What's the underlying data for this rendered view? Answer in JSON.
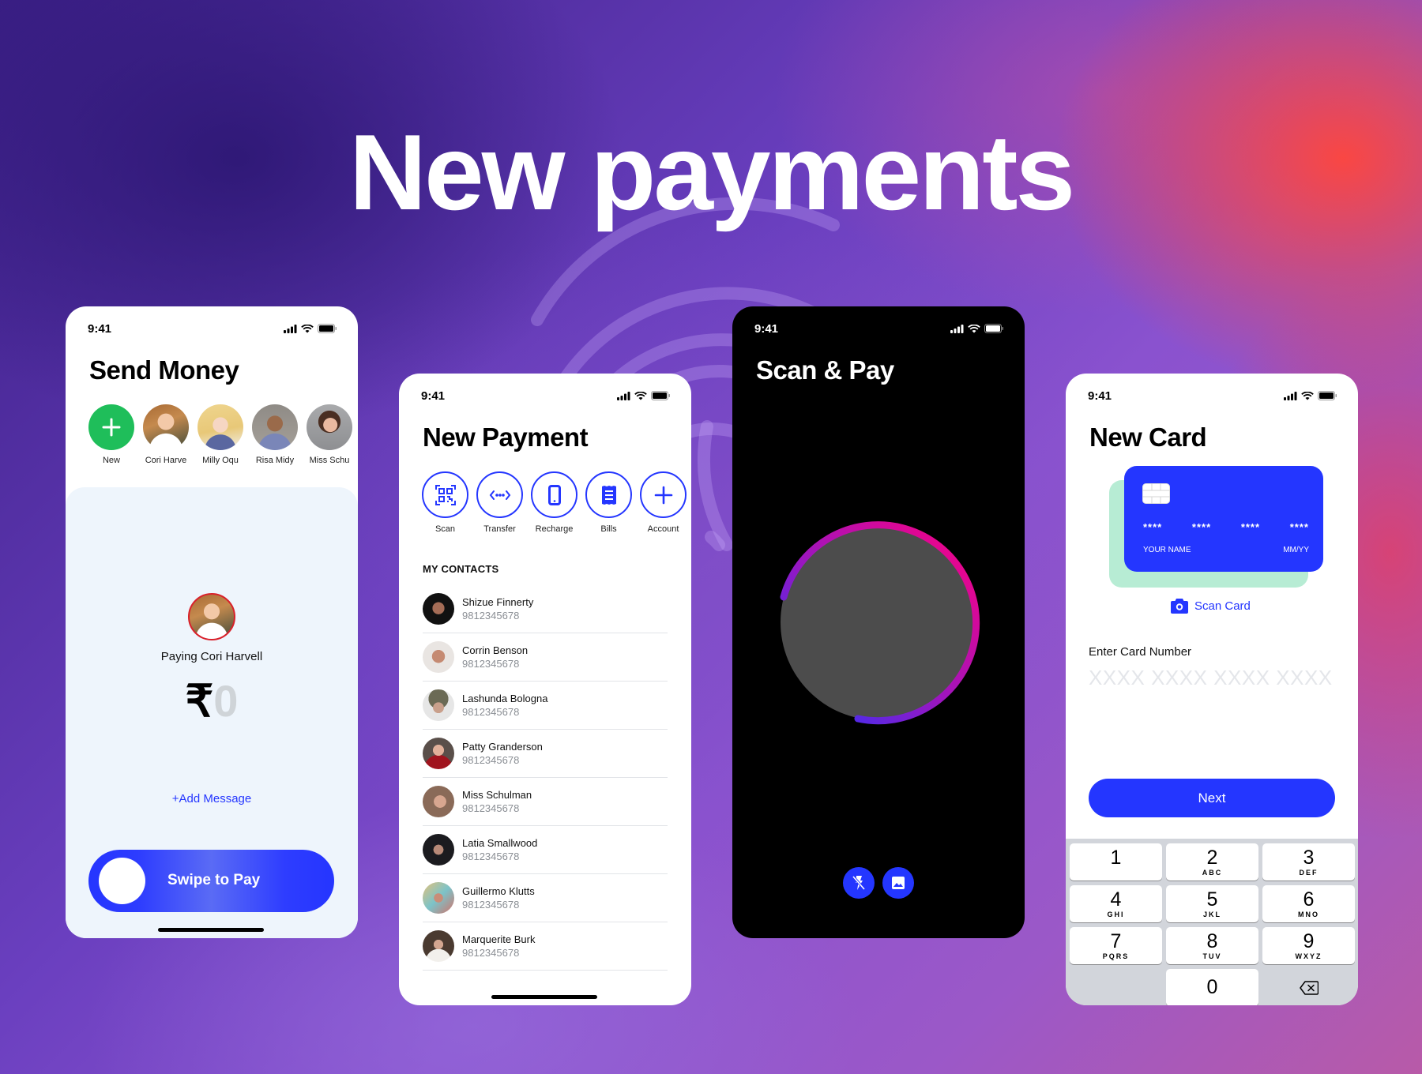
{
  "headline": "New payments",
  "colors": {
    "accent_blue": "#2436FF",
    "new_green": "#1FBE5A",
    "payee_ring_red": "#D9202A",
    "card_back_mint": "#B7ECD4",
    "scan_ring_gradient": [
      "#2436FF",
      "#8A1FC9",
      "#FF007F"
    ]
  },
  "send_money": {
    "status": {
      "time": "9:41"
    },
    "title": "Send Money",
    "recipients": [
      {
        "label": "New",
        "icon": "plus-icon"
      },
      {
        "label": "Cori Harve"
      },
      {
        "label": "Milly Oqu"
      },
      {
        "label": "Risa Midy"
      },
      {
        "label": "Miss Schu"
      }
    ],
    "paying_text": "Paying Cori Harvell",
    "currency_symbol": "₹",
    "amount": "0",
    "add_message": "+Add Message",
    "swipe_label": "Swipe to Pay"
  },
  "new_payment": {
    "status": {
      "time": "9:41"
    },
    "title": "New Payment",
    "actions": [
      {
        "label": "Scan",
        "icon": "qr-code-icon"
      },
      {
        "label": "Transfer",
        "icon": "transfer-arrows-icon"
      },
      {
        "label": "Recharge",
        "icon": "mobile-phone-icon"
      },
      {
        "label": "Bills",
        "icon": "receipt-icon"
      },
      {
        "label": "Account",
        "icon": "plus-icon"
      }
    ],
    "contacts_header": "MY CONTACTS",
    "contacts": [
      {
        "name": "Shizue Finnerty",
        "phone": "9812345678"
      },
      {
        "name": "Corrin Benson",
        "phone": "9812345678"
      },
      {
        "name": "Lashunda Bologna",
        "phone": "9812345678"
      },
      {
        "name": "Patty Granderson",
        "phone": "9812345678"
      },
      {
        "name": "Miss Schulman",
        "phone": "9812345678"
      },
      {
        "name": "Latia Smallwood",
        "phone": "9812345678"
      },
      {
        "name": "Guillermo Klutts",
        "phone": "9812345678"
      },
      {
        "name": "Marquerite Burk",
        "phone": "9812345678"
      }
    ]
  },
  "scan_pay": {
    "status": {
      "time": "9:41"
    },
    "title": "Scan & Pay",
    "controls": [
      {
        "icon": "flash-off-icon"
      },
      {
        "icon": "gallery-image-icon"
      }
    ]
  },
  "new_card": {
    "status": {
      "time": "9:41"
    },
    "title": "New Card",
    "card": {
      "number_groups": [
        "****",
        "****",
        "****",
        "****"
      ],
      "name_placeholder": "YOUR NAME",
      "expiry_placeholder": "MM/YY"
    },
    "scan_card_label": "Scan Card",
    "card_number_label": "Enter Card Number",
    "card_number_placeholder": "XXXX XXXX XXXX XXXX",
    "card_number_value": "",
    "next_label": "Next",
    "keypad": [
      {
        "digit": "1",
        "letters": ""
      },
      {
        "digit": "2",
        "letters": "ABC"
      },
      {
        "digit": "3",
        "letters": "DEF"
      },
      {
        "digit": "4",
        "letters": "GHI"
      },
      {
        "digit": "5",
        "letters": "JKL"
      },
      {
        "digit": "6",
        "letters": "MNO"
      },
      {
        "digit": "7",
        "letters": "PQRS"
      },
      {
        "digit": "8",
        "letters": "TUV"
      },
      {
        "digit": "9",
        "letters": "WXYZ"
      },
      {
        "digit": "",
        "letters": ""
      },
      {
        "digit": "0",
        "letters": ""
      },
      {
        "digit": "",
        "letters": "",
        "icon": "backspace-icon"
      }
    ]
  }
}
